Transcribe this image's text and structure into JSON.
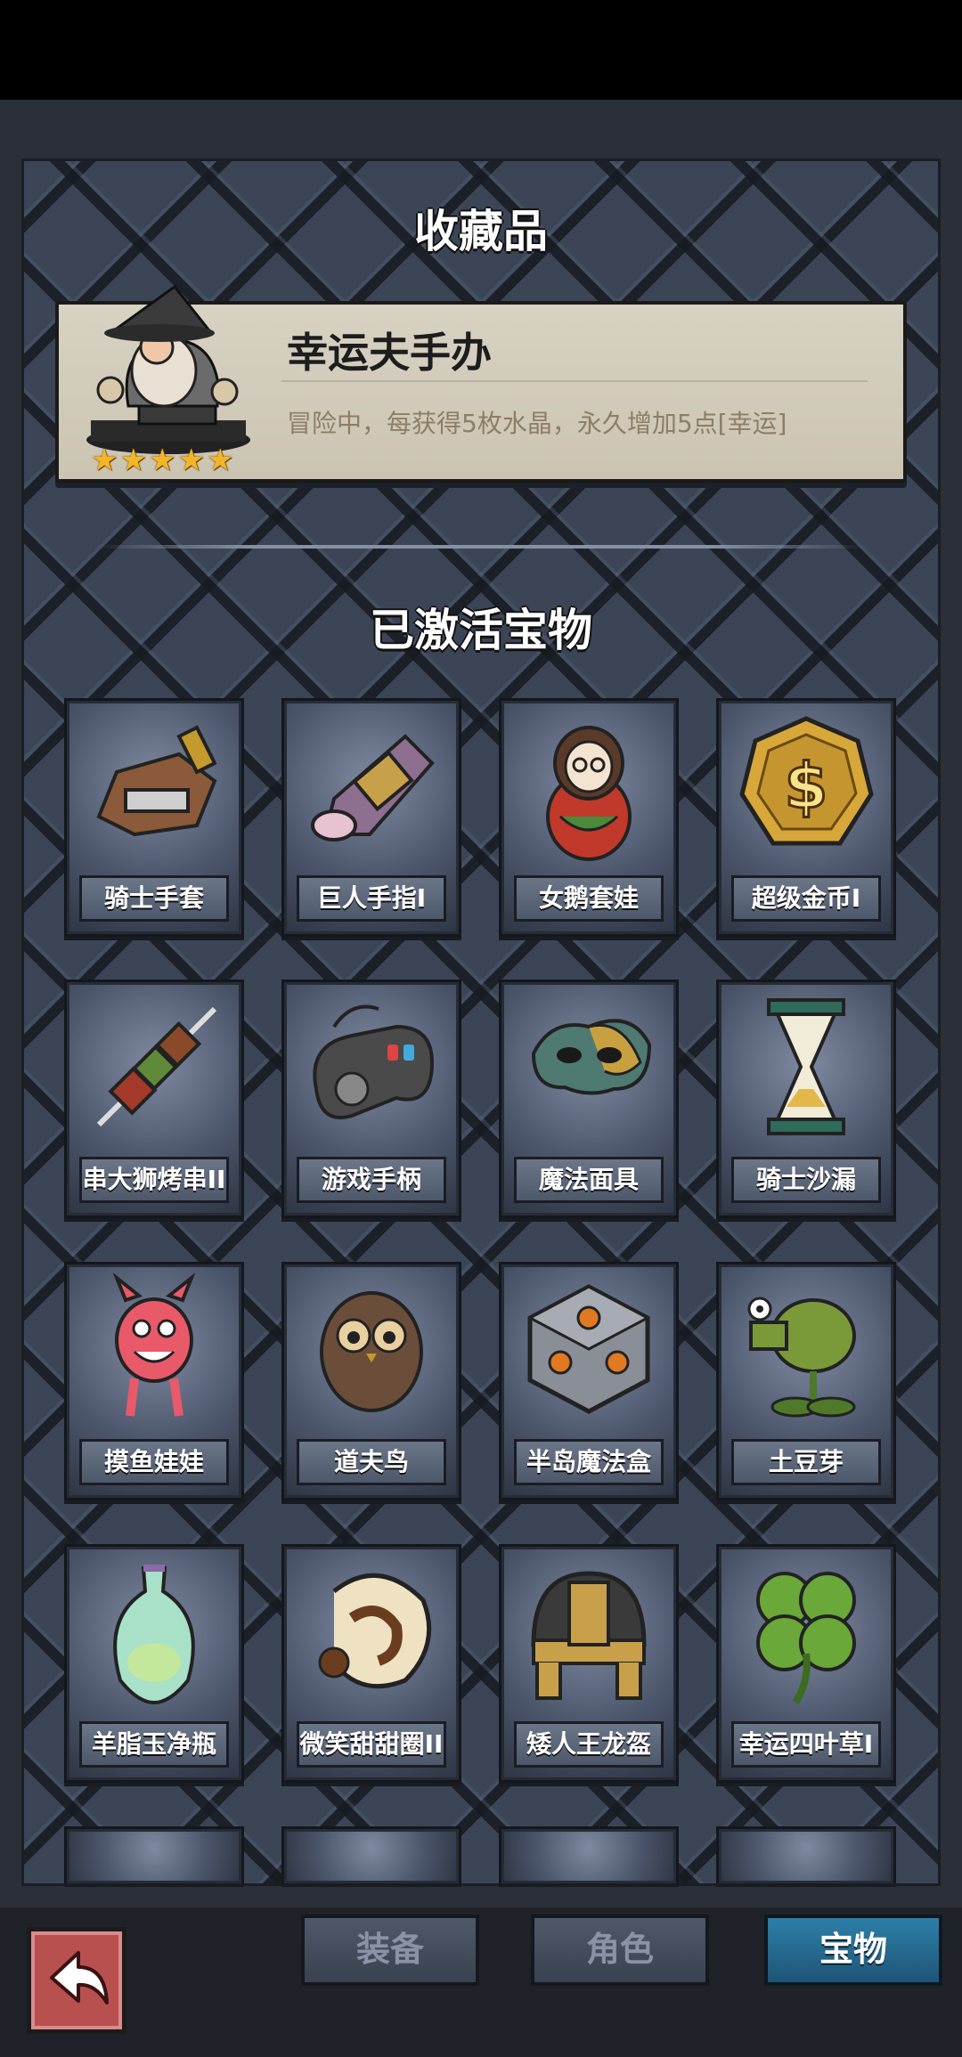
{
  "collection": {
    "title": "收藏品"
  },
  "featured": {
    "name": "幸运夫手办",
    "description": "冒险中，每获得5枚水晶，永久增加5点[幸运]",
    "stars": 5
  },
  "activated": {
    "title": "已激活宝物",
    "items": [
      {
        "label": "骑士手套",
        "icon": "knight-gauntlet-icon"
      },
      {
        "label": "巨人手指I",
        "icon": "giant-finger-icon"
      },
      {
        "label": "女鹅套娃",
        "icon": "nesting-doll-icon"
      },
      {
        "label": "超级金币I",
        "icon": "gold-coin-icon"
      },
      {
        "label": "串大狮烤串II",
        "icon": "kebab-skewer-icon"
      },
      {
        "label": "游戏手柄",
        "icon": "gamepad-icon"
      },
      {
        "label": "魔法面具",
        "icon": "magic-mask-icon"
      },
      {
        "label": "骑士沙漏",
        "icon": "hourglass-icon"
      },
      {
        "label": "摸鱼娃娃",
        "icon": "fish-doll-icon"
      },
      {
        "label": "道夫鸟",
        "icon": "owl-icon"
      },
      {
        "label": "半岛魔法盒",
        "icon": "magic-cube-icon"
      },
      {
        "label": "土豆芽",
        "icon": "pea-shooter-icon"
      },
      {
        "label": "羊脂玉净瓶",
        "icon": "jade-vase-icon"
      },
      {
        "label": "微笑甜甜圈II",
        "icon": "donut-icon"
      },
      {
        "label": "矮人王龙盔",
        "icon": "dwarf-helmet-icon"
      },
      {
        "label": "幸运四叶草I",
        "icon": "four-leaf-clover-icon"
      }
    ]
  },
  "tabs": [
    {
      "label": "装备",
      "active": false
    },
    {
      "label": "角色",
      "active": false
    },
    {
      "label": "宝物",
      "active": true
    }
  ],
  "colors": {
    "star": "#f2b627",
    "active_tab": "#2d7fa8",
    "back_button": "#b85050"
  }
}
